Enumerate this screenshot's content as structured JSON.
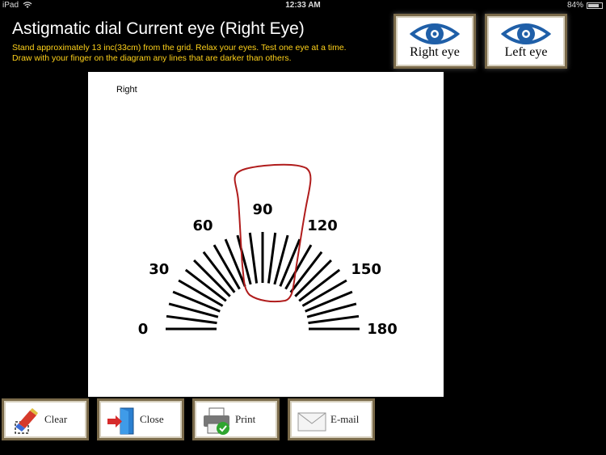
{
  "status_bar": {
    "carrier": "iPad",
    "time": "12:33 AM",
    "battery": "84%",
    "battery_level": 0.84
  },
  "header": {
    "title": "Astigmatic dial  Current eye (Right Eye)",
    "instructions": "Stand approximately 13 inc(33cm) from the grid.  Relax your eyes. Test one eye at a time.  Draw with your finger on the diagram any lines that are darker than others."
  },
  "eye_buttons": {
    "right": "Right eye",
    "left": "Left eye"
  },
  "dial": {
    "eye_label": "Right",
    "angle_labels": [
      "0",
      "30",
      "60",
      "90",
      "120",
      "150",
      "180"
    ],
    "ray_step_degrees": 7.5,
    "drawing_color": "#b01c1c"
  },
  "toolbar": {
    "clear": "Clear",
    "close": "Close",
    "print": "Print",
    "email": "E-mail"
  },
  "colors": {
    "title_text": "#ffffff",
    "instruction_text": "#ffd21a",
    "eye_icon": "#1f5fa8"
  }
}
